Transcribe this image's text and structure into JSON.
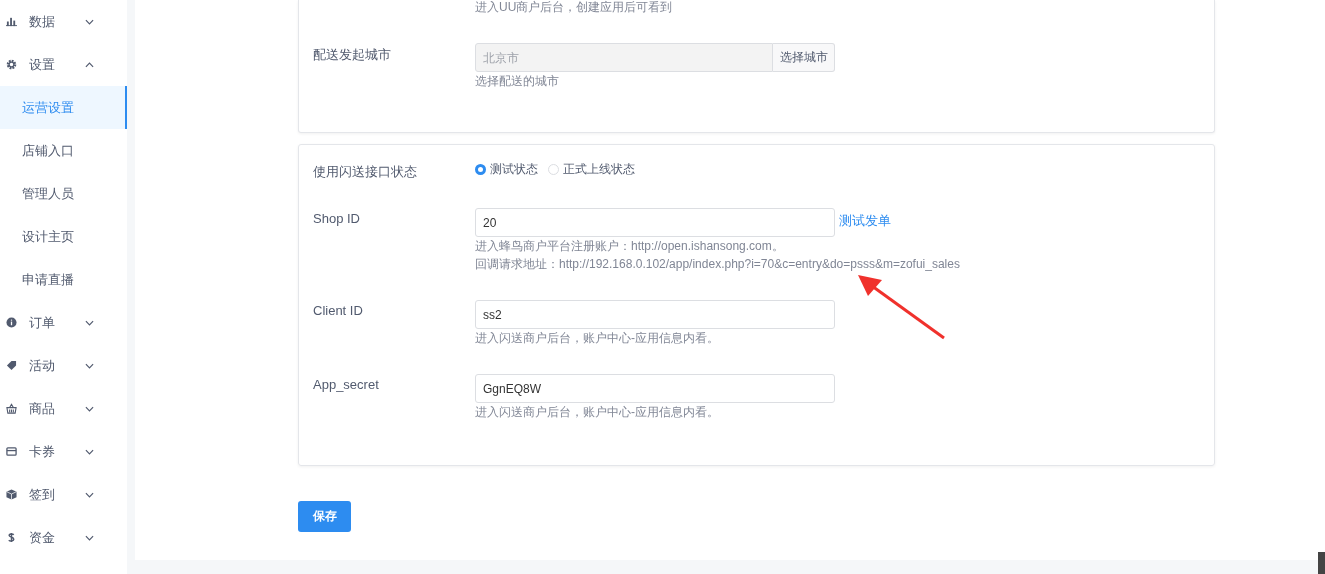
{
  "sidebar": {
    "items": [
      {
        "label": "数据",
        "expanded": false
      },
      {
        "label": "设置",
        "expanded": true,
        "children": [
          {
            "label": "运营设置",
            "selected": true
          },
          {
            "label": "店铺入口",
            "selected": false
          },
          {
            "label": "管理人员",
            "selected": false
          },
          {
            "label": "设计主页",
            "selected": false
          },
          {
            "label": "申请直播",
            "selected": false
          }
        ]
      },
      {
        "label": "订单",
        "expanded": false
      },
      {
        "label": "活动",
        "expanded": false
      },
      {
        "label": "商品",
        "expanded": false
      },
      {
        "label": "卡券",
        "expanded": false
      },
      {
        "label": "签到",
        "expanded": false
      },
      {
        "label": "资金",
        "expanded": false
      }
    ]
  },
  "cards": [
    {
      "fields": [
        {
          "kind": "hint",
          "hints": [
            "进入UU商户后台，创建应用后可看到"
          ]
        },
        {
          "kind": "picker",
          "label": "配送发起城市",
          "placeholder": "北京市",
          "button": "选择城市",
          "hints": [
            "选择配送的城市"
          ]
        }
      ]
    },
    {
      "fields": [
        {
          "kind": "radio",
          "label": "使用闪送接口状态",
          "options": [
            {
              "label": "测试状态",
              "selected": true
            },
            {
              "label": "正式上线状态",
              "selected": false
            }
          ]
        },
        {
          "kind": "text",
          "label": "Shop ID",
          "value": "20",
          "link": "测试发单",
          "hints": [
            "进入蜂鸟商户平台注册账户：http://open.ishansong.com。",
            "回调请求地址：http://192.168.0.102/app/index.php?i=70&c=entry&do=psss&m=zofui_sales"
          ]
        },
        {
          "kind": "text",
          "label": "Client ID",
          "value": "ss2",
          "hints": [
            "进入闪送商户后台，账户中心-应用信息内看。"
          ]
        },
        {
          "kind": "text",
          "label": "App_secret",
          "value": "GgnEQ8W",
          "hints": [
            "进入闪送商户后台，账户中心-应用信息内看。"
          ]
        }
      ]
    }
  ],
  "save_button": "保存"
}
